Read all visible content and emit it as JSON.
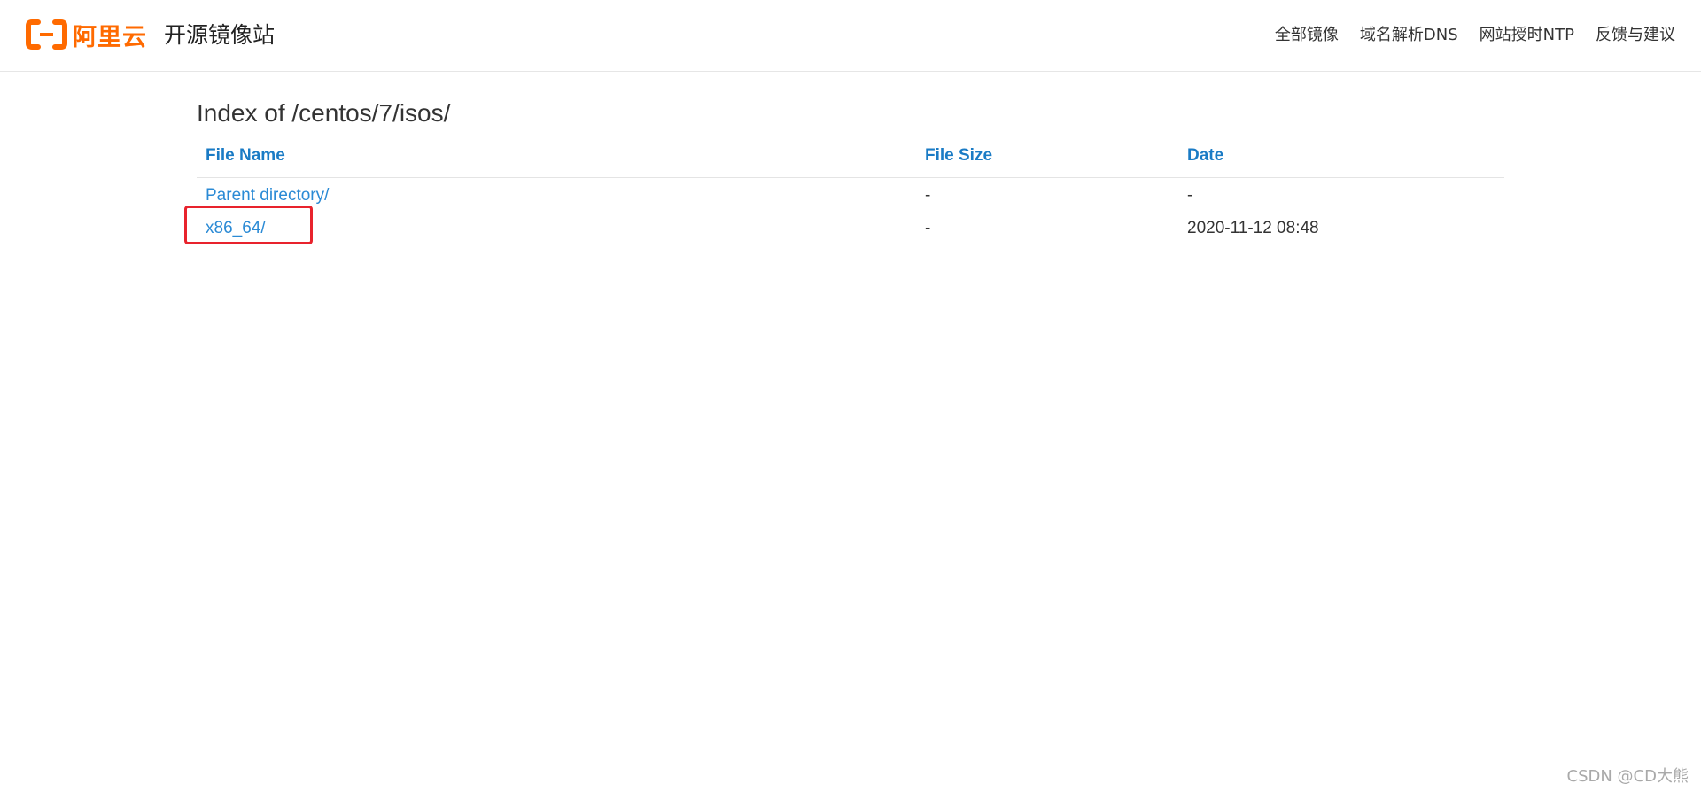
{
  "header": {
    "logo_text": "阿里云",
    "site_title": "开源镜像站",
    "brand_color": "#ff6a00",
    "nav": [
      {
        "label": "全部镜像"
      },
      {
        "label": "域名解析DNS"
      },
      {
        "label": "网站授时NTP"
      },
      {
        "label": "反馈与建议"
      }
    ]
  },
  "main": {
    "heading": "Index of /centos/7/isos/",
    "columns": {
      "name": "File Name",
      "size": "File Size",
      "date": "Date"
    },
    "rows": [
      {
        "name": "Parent directory/",
        "size": "-",
        "date": "-"
      },
      {
        "name": "x86_64/",
        "size": "-",
        "date": "2020-11-12 08:48"
      }
    ],
    "link_color": "#2a8ad5",
    "header_color": "#1a7bc5"
  },
  "annotation": {
    "highlight_color": "#e8232d",
    "highlighted_row": "x86_64/"
  },
  "watermark": "CSDN @CD大熊"
}
